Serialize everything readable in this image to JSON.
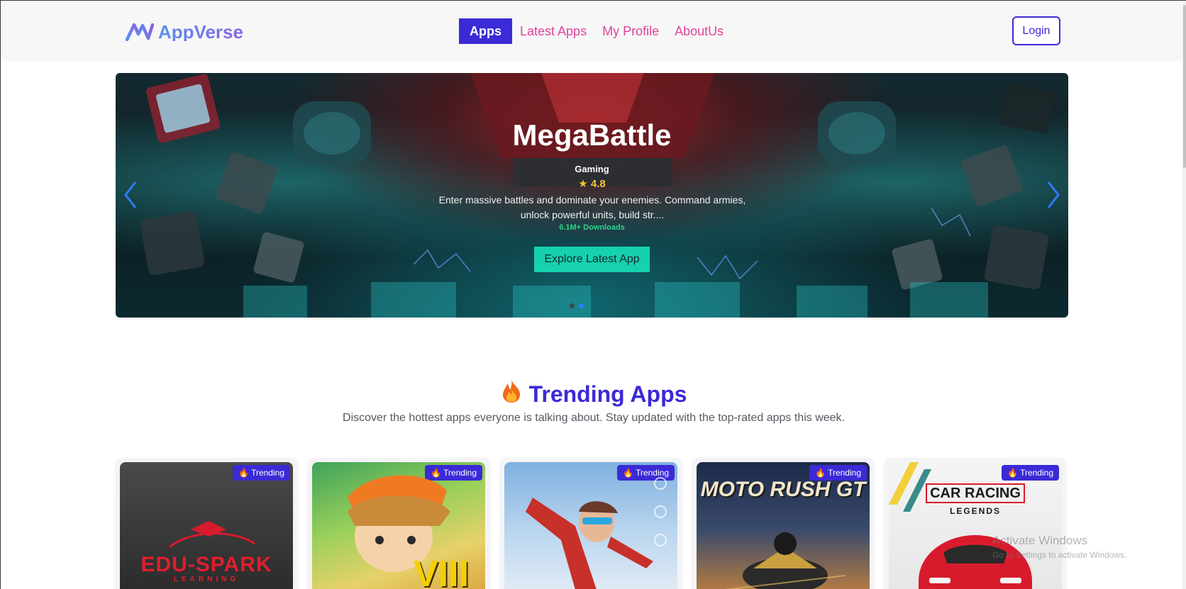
{
  "brand": {
    "name": "AppVerse",
    "logo_icon": "appverse-logo-icon",
    "colors": {
      "primary": "#3b2ad6",
      "link": "#e0439a",
      "accent": "#16d1b0"
    }
  },
  "nav": {
    "items": [
      {
        "label": "Apps",
        "active": true
      },
      {
        "label": "Latest Apps",
        "active": false
      },
      {
        "label": "My Profile",
        "active": false
      },
      {
        "label": "AboutUs",
        "active": false
      }
    ],
    "login_label": "Login"
  },
  "hero": {
    "title": "MegaBattle",
    "category": "Gaming",
    "rating_icon": "star-icon",
    "rating": "4.8",
    "description": "Enter massive battles and dominate your enemies. Command armies, unlock powerful units, build str....",
    "downloads": "6.1M+ Downloads",
    "cta_label": "Explore Latest App",
    "prev_icon": "chevron-left-icon",
    "next_icon": "chevron-right-icon",
    "slide_count": 2,
    "active_slide": 2
  },
  "trending": {
    "icon": "fire-icon",
    "title": "Trending Apps",
    "subtitle": "Discover the hottest apps everyone is talking about. Stay updated with the top-rated apps this week.",
    "badge_label": "Trending",
    "cards": [
      {
        "image_text": "EDU-SPARK",
        "image_subtext": "LEARNING"
      },
      {
        "image_text": "VIII",
        "image_subtext": ""
      },
      {
        "image_text": "",
        "image_subtext": ""
      },
      {
        "image_text": "MOTO RUSH GT",
        "image_subtext": ""
      },
      {
        "image_text": "CAR RACING",
        "image_subtext": "LEGENDS"
      }
    ]
  },
  "watermark": {
    "line1": "Activate Windows",
    "line2": "Go to Settings to activate Windows."
  }
}
